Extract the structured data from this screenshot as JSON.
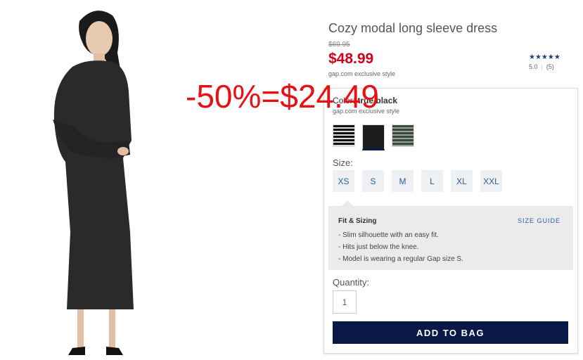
{
  "product": {
    "title": "Cozy modal long sleeve dress",
    "old_price": "$69.95",
    "sale_price": "$48.99",
    "exclusive": "gap.com exclusive style",
    "rating": {
      "stars": "★★★★★",
      "score": "5.0",
      "reviews": "(5)"
    }
  },
  "options": {
    "color_prefix": "Color:",
    "color_value": "true black",
    "color_exclusive": "gap.com exclusive style",
    "swatches": [
      "black-white-stripe",
      "true-black",
      "green-stripe"
    ],
    "size_label": "Size:",
    "sizes": [
      "XS",
      "S",
      "M",
      "L",
      "XL",
      "XXL"
    ],
    "fit": {
      "title": "Fit & Sizing",
      "size_guide": "SIZE GUIDE",
      "items": [
        "- Slim silhouette with an easy fit.",
        "- Hits just below the knee.",
        "- Model is wearing a regular Gap size S."
      ]
    },
    "quantity_label": "Quantity:",
    "quantity_value": "1",
    "add_to_bag": "ADD TO BAG"
  },
  "annotation": "-50%=$24.49",
  "colors": {
    "sale": "#d0021b",
    "link": "#2b5ea0",
    "button": "#0b1847",
    "annotation": "#e81010"
  }
}
